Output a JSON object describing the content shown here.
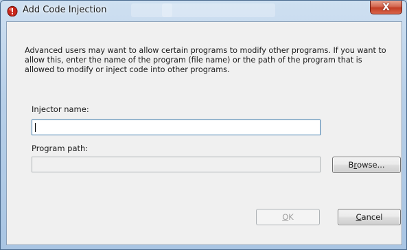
{
  "window": {
    "title": "Add Code Injection",
    "close_glyph": "X"
  },
  "colors": {
    "frame": "#b7cfe8",
    "client_bg": "#f0f0f0",
    "close_button": "#c23e24",
    "icon_red": "#c8271c"
  },
  "icons": {
    "app_icon": "shield-app-icon",
    "close_icon": "close-icon"
  },
  "dialog": {
    "description": "Advanced users may want to allow certain programs to modify other programs. If you want to allow this, enter the name of the program (file name) or the path of the program that is allowed to modify or inject code into other programs.",
    "injector_label": "Injector name:",
    "injector_value": "",
    "program_path_label": "Program path:",
    "program_path_value": "",
    "browse_pre": "B",
    "browse_mnemonic": "r",
    "browse_post": "owse...",
    "ok_mnemonic": "O",
    "ok_post": "K",
    "cancel_mnemonic": "C",
    "cancel_post": "ancel"
  }
}
